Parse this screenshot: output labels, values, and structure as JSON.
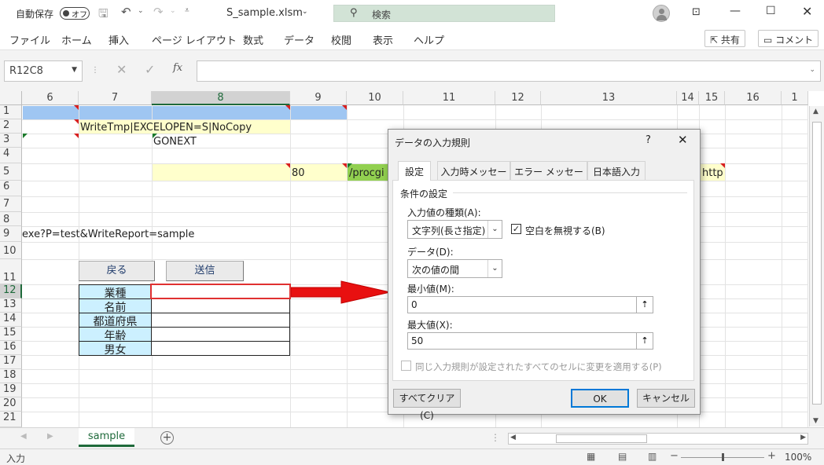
{
  "titlebar": {
    "autosave_label": "自動保存",
    "autosave_state": "オフ",
    "filename": "S_sample.xlsm",
    "search_placeholder": "検索"
  },
  "menu": {
    "items": [
      "ファイル",
      "ホーム",
      "挿入",
      "ページ レイアウト",
      "数式",
      "データ",
      "校閲",
      "表示",
      "ヘルプ"
    ],
    "share": "共有",
    "comment": "コメント"
  },
  "formula": {
    "namebox": "R12C8",
    "fx": "fx",
    "content": ""
  },
  "columns": [
    "6",
    "7",
    "8",
    "9",
    "10",
    "11",
    "12",
    "13",
    "14",
    "15",
    "16",
    "1"
  ],
  "rows": [
    "1",
    "2",
    "3",
    "4",
    "5",
    "6",
    "7",
    "8",
    "9",
    "10",
    "11",
    "12",
    "13",
    "14",
    "15",
    "16",
    "17",
    "18",
    "19",
    "20",
    "21"
  ],
  "cells": {
    "r2_writetmp": "WriteTmp",
    "r2_excelopen": "EXCELOPEN=S",
    "r2_nocopy": "NoCopy",
    "r3_gonext": "GONEXT",
    "r5_80": "80",
    "r5_procgi": "/procgi",
    "r5_http": "http",
    "r9_exe": "exe?P=test&WriteReport=sample"
  },
  "buttons": {
    "back": "戻る",
    "send": "送信"
  },
  "form_labels": [
    "業種",
    "名前",
    "都道府県",
    "年齢",
    "男女"
  ],
  "sheet_tab": "sample",
  "status": {
    "mode": "入力",
    "zoom": "100%"
  },
  "dialog": {
    "title": "データの入力規則",
    "help": "?",
    "tabs": [
      "設定",
      "入力時メッセージ",
      "エラー メッセージ",
      "日本語入力"
    ],
    "section": "条件の設定",
    "type_label": "入力値の種類(A):",
    "type_value": "文字列(長さ指定)",
    "ignore_blank": "空白を無視する(B)",
    "data_label": "データ(D):",
    "data_value": "次の値の間",
    "min_label": "最小値(M):",
    "min_value": "0",
    "max_label": "最大値(X):",
    "max_value": "50",
    "apply_all": "同じ入力規則が設定されたすべてのセルに変更を適用する(P)",
    "clear_all": "すべてクリア(C)",
    "ok": "OK",
    "cancel": "キャンセル"
  }
}
